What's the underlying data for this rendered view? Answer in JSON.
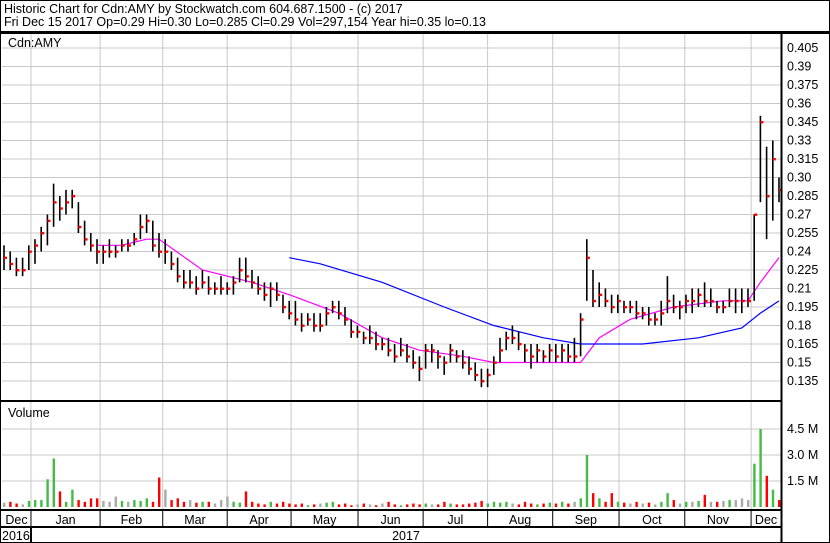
{
  "header": {
    "title": "Historic Chart for Cdn:AMY by Stockwatch.com 604.687.1500 - (c) 2017",
    "quote": "Fri Dec 15 2017  Op=0.29  Hi=0.30  Lo=0.285  Cl=0.29  Vol=297,154  Year hi=0.35  lo=0.13"
  },
  "colors": {
    "bar": "#000000",
    "close": "#ff0000",
    "ma_short": "#ff00ff",
    "ma_long": "#0000ff",
    "vol_up": "#44bb44",
    "vol_down": "#ff0000",
    "vol_flat": "#aaaaaa",
    "grid": "#c8c8c8"
  },
  "chart_data": {
    "type": "ohlc",
    "title": "Cdn:AMY",
    "volume_label": "Volume",
    "price_ticks": [
      "0.405",
      "0.39",
      "0.375",
      "0.36",
      "0.345",
      "0.33",
      "0.315",
      "0.30",
      "0.285",
      "0.27",
      "0.255",
      "0.24",
      "0.225",
      "0.21",
      "0.195",
      "0.18",
      "0.165",
      "0.15",
      "0.135"
    ],
    "ylim": [
      0.135,
      0.405
    ],
    "volume_ticks": [
      {
        "label": "4.5 M",
        "value": 4.5
      },
      {
        "label": "3.0 M",
        "value": 3.0
      },
      {
        "label": "1.5 M",
        "value": 1.5
      }
    ],
    "months": [
      {
        "label": "Dec",
        "start": 0
      },
      {
        "label": "Jan",
        "start": 4.35
      },
      {
        "label": "Feb",
        "start": 15.5
      },
      {
        "label": "Mar",
        "start": 25.6
      },
      {
        "label": "Apr",
        "start": 36
      },
      {
        "label": "May",
        "start": 46.3
      },
      {
        "label": "Jun",
        "start": 57.1
      },
      {
        "label": "Jul",
        "start": 67.6
      },
      {
        "label": "Aug",
        "start": 78
      },
      {
        "label": "Sep",
        "start": 88.5
      },
      {
        "label": "Oct",
        "start": 99.2
      },
      {
        "label": "Nov",
        "start": 109.8
      },
      {
        "label": "Dec",
        "start": 120.5
      }
    ],
    "years": [
      {
        "label": "2016"
      },
      {
        "label": "2017"
      }
    ],
    "bars_hlc": [
      [
        0.245,
        0.225,
        0.235
      ],
      [
        0.24,
        0.225,
        0.23
      ],
      [
        0.235,
        0.22,
        0.225
      ],
      [
        0.235,
        0.22,
        0.225
      ],
      [
        0.245,
        0.225,
        0.24
      ],
      [
        0.25,
        0.23,
        0.245
      ],
      [
        0.26,
        0.24,
        0.255
      ],
      [
        0.27,
        0.245,
        0.265
      ],
      [
        0.295,
        0.26,
        0.28
      ],
      [
        0.285,
        0.265,
        0.275
      ],
      [
        0.29,
        0.27,
        0.28
      ],
      [
        0.29,
        0.275,
        0.285
      ],
      [
        0.28,
        0.255,
        0.26
      ],
      [
        0.265,
        0.245,
        0.25
      ],
      [
        0.255,
        0.24,
        0.245
      ],
      [
        0.25,
        0.23,
        0.24
      ],
      [
        0.245,
        0.23,
        0.24
      ],
      [
        0.25,
        0.235,
        0.24
      ],
      [
        0.245,
        0.235,
        0.24
      ],
      [
        0.25,
        0.24,
        0.245
      ],
      [
        0.25,
        0.24,
        0.245
      ],
      [
        0.255,
        0.245,
        0.25
      ],
      [
        0.27,
        0.25,
        0.26
      ],
      [
        0.27,
        0.255,
        0.265
      ],
      [
        0.265,
        0.24,
        0.245
      ],
      [
        0.255,
        0.235,
        0.24
      ],
      [
        0.25,
        0.23,
        0.24
      ],
      [
        0.24,
        0.225,
        0.23
      ],
      [
        0.235,
        0.215,
        0.22
      ],
      [
        0.225,
        0.21,
        0.215
      ],
      [
        0.225,
        0.21,
        0.215
      ],
      [
        0.22,
        0.205,
        0.21
      ],
      [
        0.225,
        0.21,
        0.215
      ],
      [
        0.22,
        0.205,
        0.21
      ],
      [
        0.215,
        0.205,
        0.21
      ],
      [
        0.22,
        0.205,
        0.21
      ],
      [
        0.215,
        0.205,
        0.21
      ],
      [
        0.22,
        0.205,
        0.215
      ],
      [
        0.235,
        0.215,
        0.225
      ],
      [
        0.235,
        0.215,
        0.22
      ],
      [
        0.225,
        0.21,
        0.215
      ],
      [
        0.22,
        0.205,
        0.21
      ],
      [
        0.215,
        0.2,
        0.205
      ],
      [
        0.215,
        0.195,
        0.21
      ],
      [
        0.215,
        0.2,
        0.205
      ],
      [
        0.205,
        0.19,
        0.195
      ],
      [
        0.2,
        0.185,
        0.19
      ],
      [
        0.2,
        0.18,
        0.185
      ],
      [
        0.19,
        0.175,
        0.18
      ],
      [
        0.19,
        0.18,
        0.185
      ],
      [
        0.19,
        0.175,
        0.18
      ],
      [
        0.19,
        0.175,
        0.18
      ],
      [
        0.195,
        0.18,
        0.19
      ],
      [
        0.2,
        0.19,
        0.195
      ],
      [
        0.2,
        0.185,
        0.19
      ],
      [
        0.195,
        0.18,
        0.185
      ],
      [
        0.185,
        0.17,
        0.175
      ],
      [
        0.18,
        0.17,
        0.175
      ],
      [
        0.175,
        0.165,
        0.17
      ],
      [
        0.18,
        0.165,
        0.17
      ],
      [
        0.175,
        0.16,
        0.165
      ],
      [
        0.17,
        0.16,
        0.165
      ],
      [
        0.17,
        0.155,
        0.16
      ],
      [
        0.165,
        0.15,
        0.155
      ],
      [
        0.17,
        0.155,
        0.16
      ],
      [
        0.165,
        0.15,
        0.155
      ],
      [
        0.16,
        0.145,
        0.15
      ],
      [
        0.155,
        0.135,
        0.145
      ],
      [
        0.165,
        0.145,
        0.16
      ],
      [
        0.165,
        0.15,
        0.16
      ],
      [
        0.16,
        0.145,
        0.155
      ],
      [
        0.155,
        0.14,
        0.15
      ],
      [
        0.165,
        0.15,
        0.16
      ],
      [
        0.16,
        0.15,
        0.155
      ],
      [
        0.16,
        0.145,
        0.15
      ],
      [
        0.155,
        0.14,
        0.145
      ],
      [
        0.15,
        0.135,
        0.14
      ],
      [
        0.145,
        0.13,
        0.135
      ],
      [
        0.145,
        0.13,
        0.14
      ],
      [
        0.155,
        0.14,
        0.15
      ],
      [
        0.17,
        0.15,
        0.16
      ],
      [
        0.175,
        0.16,
        0.17
      ],
      [
        0.18,
        0.165,
        0.17
      ],
      [
        0.175,
        0.16,
        0.165
      ],
      [
        0.165,
        0.15,
        0.16
      ],
      [
        0.165,
        0.145,
        0.155
      ],
      [
        0.165,
        0.15,
        0.16
      ],
      [
        0.16,
        0.15,
        0.155
      ],
      [
        0.165,
        0.15,
        0.16
      ],
      [
        0.165,
        0.15,
        0.155
      ],
      [
        0.165,
        0.15,
        0.16
      ],
      [
        0.165,
        0.15,
        0.155
      ],
      [
        0.17,
        0.15,
        0.155
      ],
      [
        0.19,
        0.155,
        0.185
      ],
      [
        0.25,
        0.2,
        0.235
      ],
      [
        0.225,
        0.195,
        0.2
      ],
      [
        0.215,
        0.195,
        0.205
      ],
      [
        0.21,
        0.195,
        0.2
      ],
      [
        0.205,
        0.19,
        0.195
      ],
      [
        0.205,
        0.19,
        0.2
      ],
      [
        0.2,
        0.19,
        0.195
      ],
      [
        0.2,
        0.19,
        0.195
      ],
      [
        0.2,
        0.185,
        0.19
      ],
      [
        0.195,
        0.185,
        0.19
      ],
      [
        0.195,
        0.18,
        0.185
      ],
      [
        0.19,
        0.18,
        0.185
      ],
      [
        0.2,
        0.18,
        0.19
      ],
      [
        0.22,
        0.19,
        0.2
      ],
      [
        0.205,
        0.19,
        0.195
      ],
      [
        0.2,
        0.185,
        0.195
      ],
      [
        0.205,
        0.19,
        0.2
      ],
      [
        0.21,
        0.19,
        0.2
      ],
      [
        0.21,
        0.195,
        0.205
      ],
      [
        0.215,
        0.195,
        0.2
      ],
      [
        0.21,
        0.195,
        0.2
      ],
      [
        0.2,
        0.19,
        0.195
      ],
      [
        0.2,
        0.19,
        0.195
      ],
      [
        0.21,
        0.195,
        0.2
      ],
      [
        0.21,
        0.19,
        0.2
      ],
      [
        0.21,
        0.19,
        0.2
      ],
      [
        0.21,
        0.195,
        0.2
      ],
      [
        0.27,
        0.2,
        0.27
      ],
      [
        0.35,
        0.28,
        0.345
      ],
      [
        0.325,
        0.25,
        0.285
      ],
      [
        0.33,
        0.265,
        0.315
      ],
      [
        0.3,
        0.28,
        0.29
      ]
    ],
    "volume_millions": [
      0.25,
      0.3,
      0.2,
      0.15,
      0.35,
      0.4,
      0.4,
      1.6,
      2.8,
      0.9,
      0.3,
      1.0,
      0.4,
      0.3,
      0.5,
      0.5,
      0.35,
      0.3,
      0.6,
      0.35,
      0.3,
      0.4,
      0.35,
      0.5,
      0.3,
      1.7,
      1.0,
      0.4,
      0.5,
      0.3,
      0.4,
      0.25,
      0.3,
      0.3,
      0.2,
      0.4,
      0.6,
      0.3,
      0.25,
      0.9,
      0.3,
      0.2,
      0.15,
      0.3,
      0.2,
      0.3,
      0.2,
      0.15,
      0.2,
      0.1,
      0.15,
      0.2,
      0.25,
      0.3,
      0.15,
      0.2,
      0.1,
      0.15,
      0.2,
      0.15,
      0.1,
      0.2,
      0.3,
      0.15,
      0.1,
      0.15,
      0.2,
      0.15,
      0.2,
      0.15,
      0.15,
      0.3,
      0.2,
      0.15,
      0.15,
      0.2,
      0.25,
      0.35,
      0.2,
      0.3,
      0.25,
      0.3,
      0.2,
      0.15,
      0.3,
      0.2,
      0.15,
      0.2,
      0.25,
      0.2,
      0.3,
      0.2,
      0.3,
      0.5,
      3.0,
      0.8,
      0.5,
      0.3,
      0.8,
      0.3,
      0.25,
      0.2,
      0.3,
      0.2,
      0.25,
      0.15,
      0.3,
      0.8,
      0.4,
      0.2,
      0.3,
      0.3,
      0.35,
      0.7,
      0.3,
      0.3,
      0.35,
      0.4,
      0.4,
      0.5,
      0.4,
      2.5,
      4.5,
      1.8,
      1.0,
      0.4
    ],
    "ma_short": [
      [
        15,
        0.245
      ],
      [
        19,
        0.245
      ],
      [
        23,
        0.25
      ],
      [
        25,
        0.25
      ],
      [
        32,
        0.225
      ],
      [
        40,
        0.215
      ],
      [
        46,
        0.205
      ],
      [
        54,
        0.19
      ],
      [
        61,
        0.17
      ],
      [
        67,
        0.16
      ],
      [
        74,
        0.155
      ],
      [
        79,
        0.15
      ],
      [
        87,
        0.15
      ],
      [
        93,
        0.15
      ],
      [
        96,
        0.17
      ],
      [
        101,
        0.185
      ],
      [
        108,
        0.195
      ],
      [
        116,
        0.2
      ],
      [
        120,
        0.2
      ],
      [
        122,
        0.215
      ],
      [
        125,
        0.235
      ]
    ],
    "ma_long": [
      [
        46,
        0.235
      ],
      [
        51,
        0.23
      ],
      [
        61,
        0.215
      ],
      [
        71,
        0.195
      ],
      [
        79,
        0.18
      ],
      [
        87,
        0.17
      ],
      [
        93,
        0.165
      ],
      [
        103,
        0.165
      ],
      [
        112,
        0.17
      ],
      [
        119,
        0.178
      ],
      [
        122,
        0.19
      ],
      [
        125,
        0.2
      ]
    ]
  }
}
